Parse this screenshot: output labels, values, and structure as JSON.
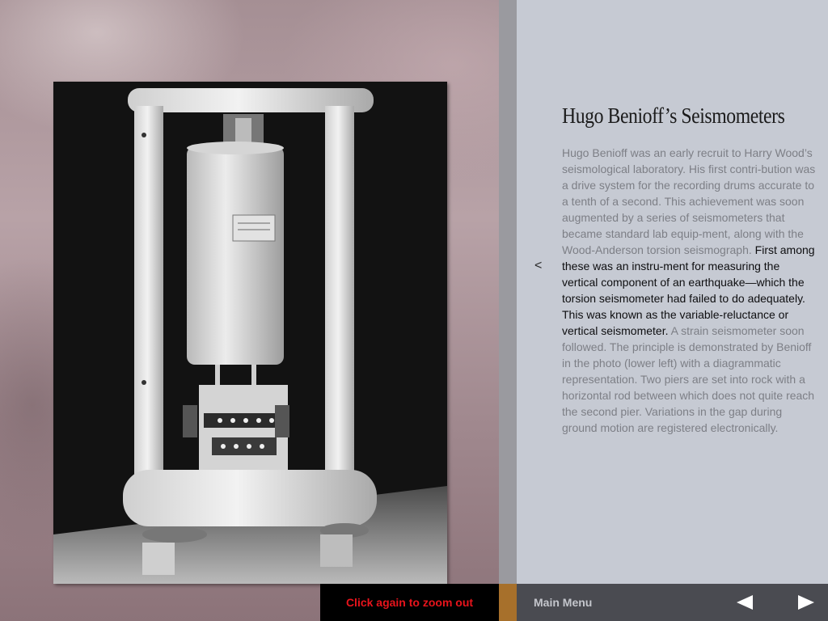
{
  "article": {
    "title": "Hugo Benioff’s Seismometers",
    "para_intro": "Hugo Benioff was an early recruit to Harry Wood’s seismological laboratory. His first contri-bution was a drive system for the recording drums accurate to a tenth of a second. This achievement was soon augmented by a series of seismometers that became standard lab equip-ment, along with the Wood-Anderson torsion seismograph.",
    "para_highlight": "First among these was an instru-ment for measuring the vertical component of an earthquake—which the torsion seismometer had failed to do adequately. This was known as the variable-reluctance or vertical seismometer.",
    "para_outro": "A strain seismometer soon followed. The principle is demonstrated by Benioff in the photo (lower left) with a diagrammatic representation. Two piers are set into rock with a horizontal rod between which does not quite reach the second pier. Variations in the gap during ground motion are registered electronically."
  },
  "back_glyph": "<",
  "bottom": {
    "zoom_label": "Click again to zoom out",
    "main_menu_label": "Main Menu"
  },
  "icons": {
    "prev": "triangle-left-icon",
    "next": "triangle-right-icon",
    "back": "chevron-left-icon"
  },
  "colors": {
    "zoom_text": "#e8141c",
    "nav_bar": "#4a4b51",
    "accent_strip": "#a7702b",
    "panel": "#c6cad3"
  }
}
